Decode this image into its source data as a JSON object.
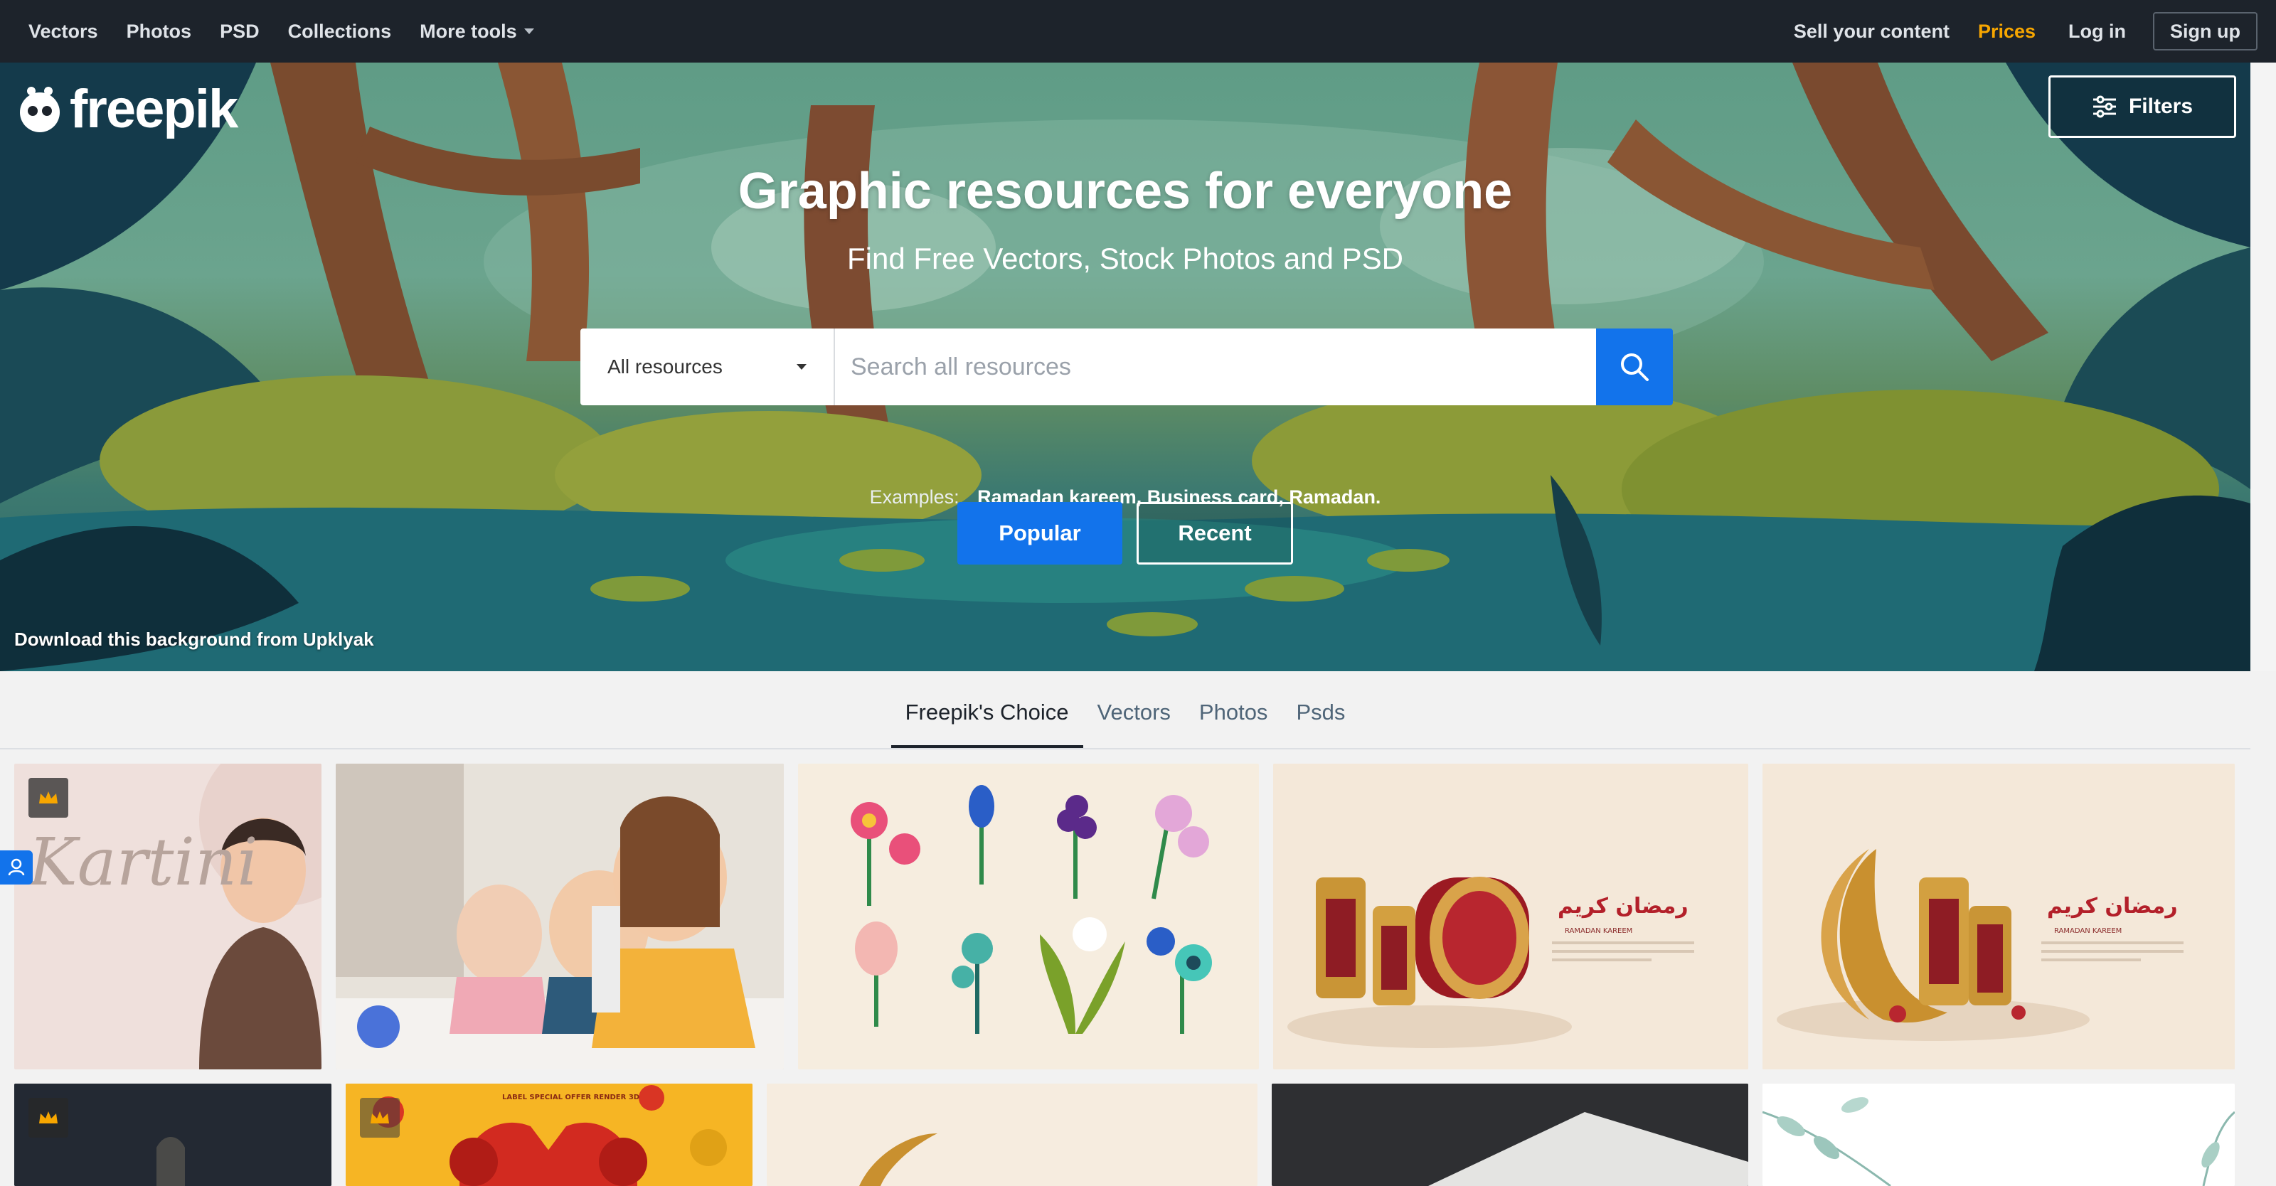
{
  "topnav": {
    "left": [
      {
        "label": "Vectors"
      },
      {
        "label": "Photos"
      },
      {
        "label": "PSD"
      },
      {
        "label": "Collections"
      },
      {
        "label": "More tools"
      }
    ],
    "right": {
      "sell": "Sell your content",
      "prices": "Prices",
      "login": "Log in",
      "signup": "Sign up"
    }
  },
  "hero": {
    "logo": "freepik",
    "filters": "Filters",
    "title": "Graphic resources for everyone",
    "subtitle": "Find Free Vectors, Stock Photos and PSD",
    "search": {
      "resource_select": "All resources",
      "placeholder": "Search all resources"
    },
    "examples": {
      "label": "Examples:",
      "items": [
        "Ramadan kareem,",
        "Business card,",
        "Ramadan."
      ]
    },
    "tabs": {
      "popular": "Popular",
      "recent": "Recent"
    },
    "credit": "Download this background from Upklyak"
  },
  "category_tabs": [
    {
      "label": "Freepik's Choice",
      "active": true
    },
    {
      "label": "Vectors"
    },
    {
      "label": "Photos"
    },
    {
      "label": "Psds"
    }
  ],
  "cards": {
    "kartini_word": "Kartini",
    "ramadan_arabic": "رمضان كريم",
    "ramadan_sub": "RAMADAN KAREEM",
    "promo_banner": "LABEL SPECIAL OFFER RENDER 3D"
  },
  "colors": {
    "nav_bg": "#1d232b",
    "accent_blue": "#1273eb",
    "prices": "#f7a600"
  }
}
